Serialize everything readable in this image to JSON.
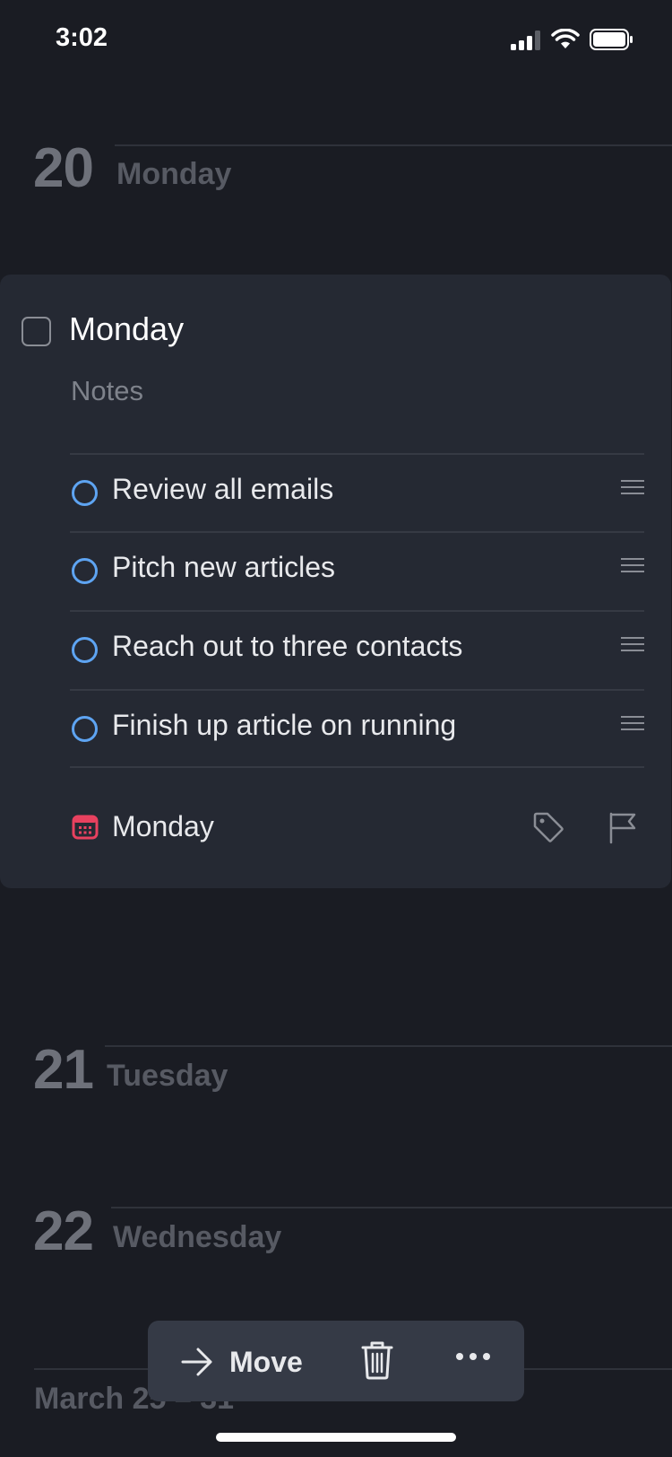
{
  "status_bar": {
    "time": "3:02"
  },
  "days": [
    {
      "number": "20",
      "name": "Monday"
    },
    {
      "number": "21",
      "name": "Tuesday"
    },
    {
      "number": "22",
      "name": "Wednesday"
    }
  ],
  "task": {
    "title": "Monday",
    "notes_placeholder": "Notes",
    "checklist": [
      {
        "label": "Review all emails"
      },
      {
        "label": "Pitch new articles"
      },
      {
        "label": "Reach out to three contacts"
      },
      {
        "label": "Finish up article on running"
      }
    ],
    "when_label": "Monday",
    "icons": {
      "when": "calendar-icon",
      "tag": "tag-icon",
      "flag": "flag-icon"
    }
  },
  "upcoming_range": "March 25 – 31",
  "toolbar": {
    "move_label": "Move"
  },
  "colors": {
    "background": "#1a1c23",
    "card": "#252933",
    "checklist_circle": "#5ea4f2",
    "calendar_accent": "#e8415f",
    "toolbar": "#353a46"
  }
}
